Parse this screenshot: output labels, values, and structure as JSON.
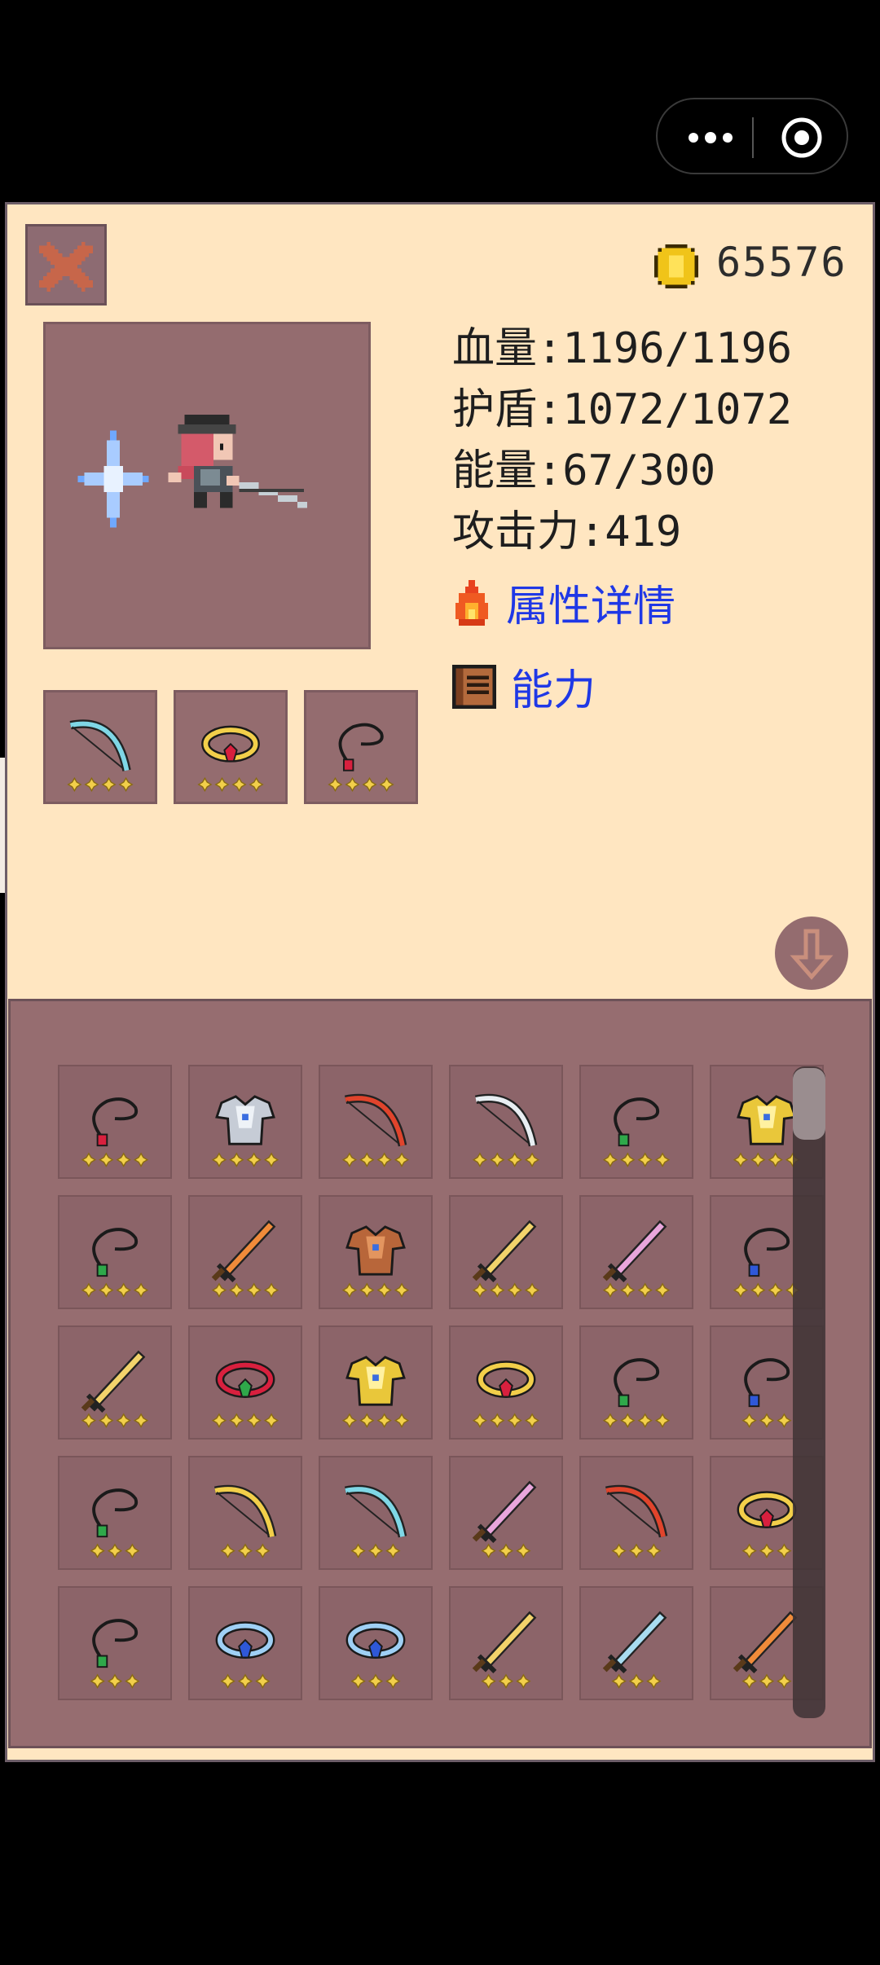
{
  "header": {
    "gold": "65576"
  },
  "stats": {
    "hp": "血量:1196/1196",
    "shield": "护盾:1072/1072",
    "energy": "能量:67/300",
    "attack": "攻击力:419"
  },
  "links": {
    "details": "属性详情",
    "ability": "能力"
  },
  "equipped": [
    {
      "item": "bow-teal",
      "stars": 4
    },
    {
      "item": "ring-gold-red",
      "stars": 4
    },
    {
      "item": "necklace-red",
      "stars": 4
    }
  ],
  "inventory": [
    {
      "item": "necklace-red",
      "stars": 4
    },
    {
      "item": "armor-silver",
      "stars": 4
    },
    {
      "item": "bow-red",
      "stars": 4
    },
    {
      "item": "bow-white",
      "stars": 4
    },
    {
      "item": "necklace-green",
      "stars": 4
    },
    {
      "item": "armor-gold",
      "stars": 4
    },
    {
      "item": "necklace-green",
      "stars": 4
    },
    {
      "item": "sword-orange",
      "stars": 4
    },
    {
      "item": "armor-bronze",
      "stars": 4
    },
    {
      "item": "sword-gold",
      "stars": 4
    },
    {
      "item": "sword-pink",
      "stars": 4
    },
    {
      "item": "necklace-blue",
      "stars": 4
    },
    {
      "item": "dagger-gold",
      "stars": 4
    },
    {
      "item": "ring-red-green",
      "stars": 4
    },
    {
      "item": "armor-gold",
      "stars": 4
    },
    {
      "item": "ring-gold-red",
      "stars": 4
    },
    {
      "item": "necklace-green",
      "stars": 4
    },
    {
      "item": "necklace-blue",
      "stars": 3
    },
    {
      "item": "necklace-green",
      "stars": 3
    },
    {
      "item": "bow-gold",
      "stars": 3
    },
    {
      "item": "bow-teal",
      "stars": 3
    },
    {
      "item": "sword-pink",
      "stars": 3
    },
    {
      "item": "bow-red",
      "stars": 3
    },
    {
      "item": "ring-gold-red",
      "stars": 3
    },
    {
      "item": "necklace-green",
      "stars": 3
    },
    {
      "item": "ring-blue",
      "stars": 3
    },
    {
      "item": "ring-blue",
      "stars": 3
    },
    {
      "item": "sword-gold",
      "stars": 3
    },
    {
      "item": "sword-cyan",
      "stars": 3
    },
    {
      "item": "sword-orange",
      "stars": 3
    }
  ],
  "colors": {
    "panel_bg": "#ffe6c1",
    "slot_bg": "#8c6469",
    "inventory_bg": "#966d70",
    "link_blue": "#1f38e6",
    "star_gold": "#f2cf4a"
  }
}
